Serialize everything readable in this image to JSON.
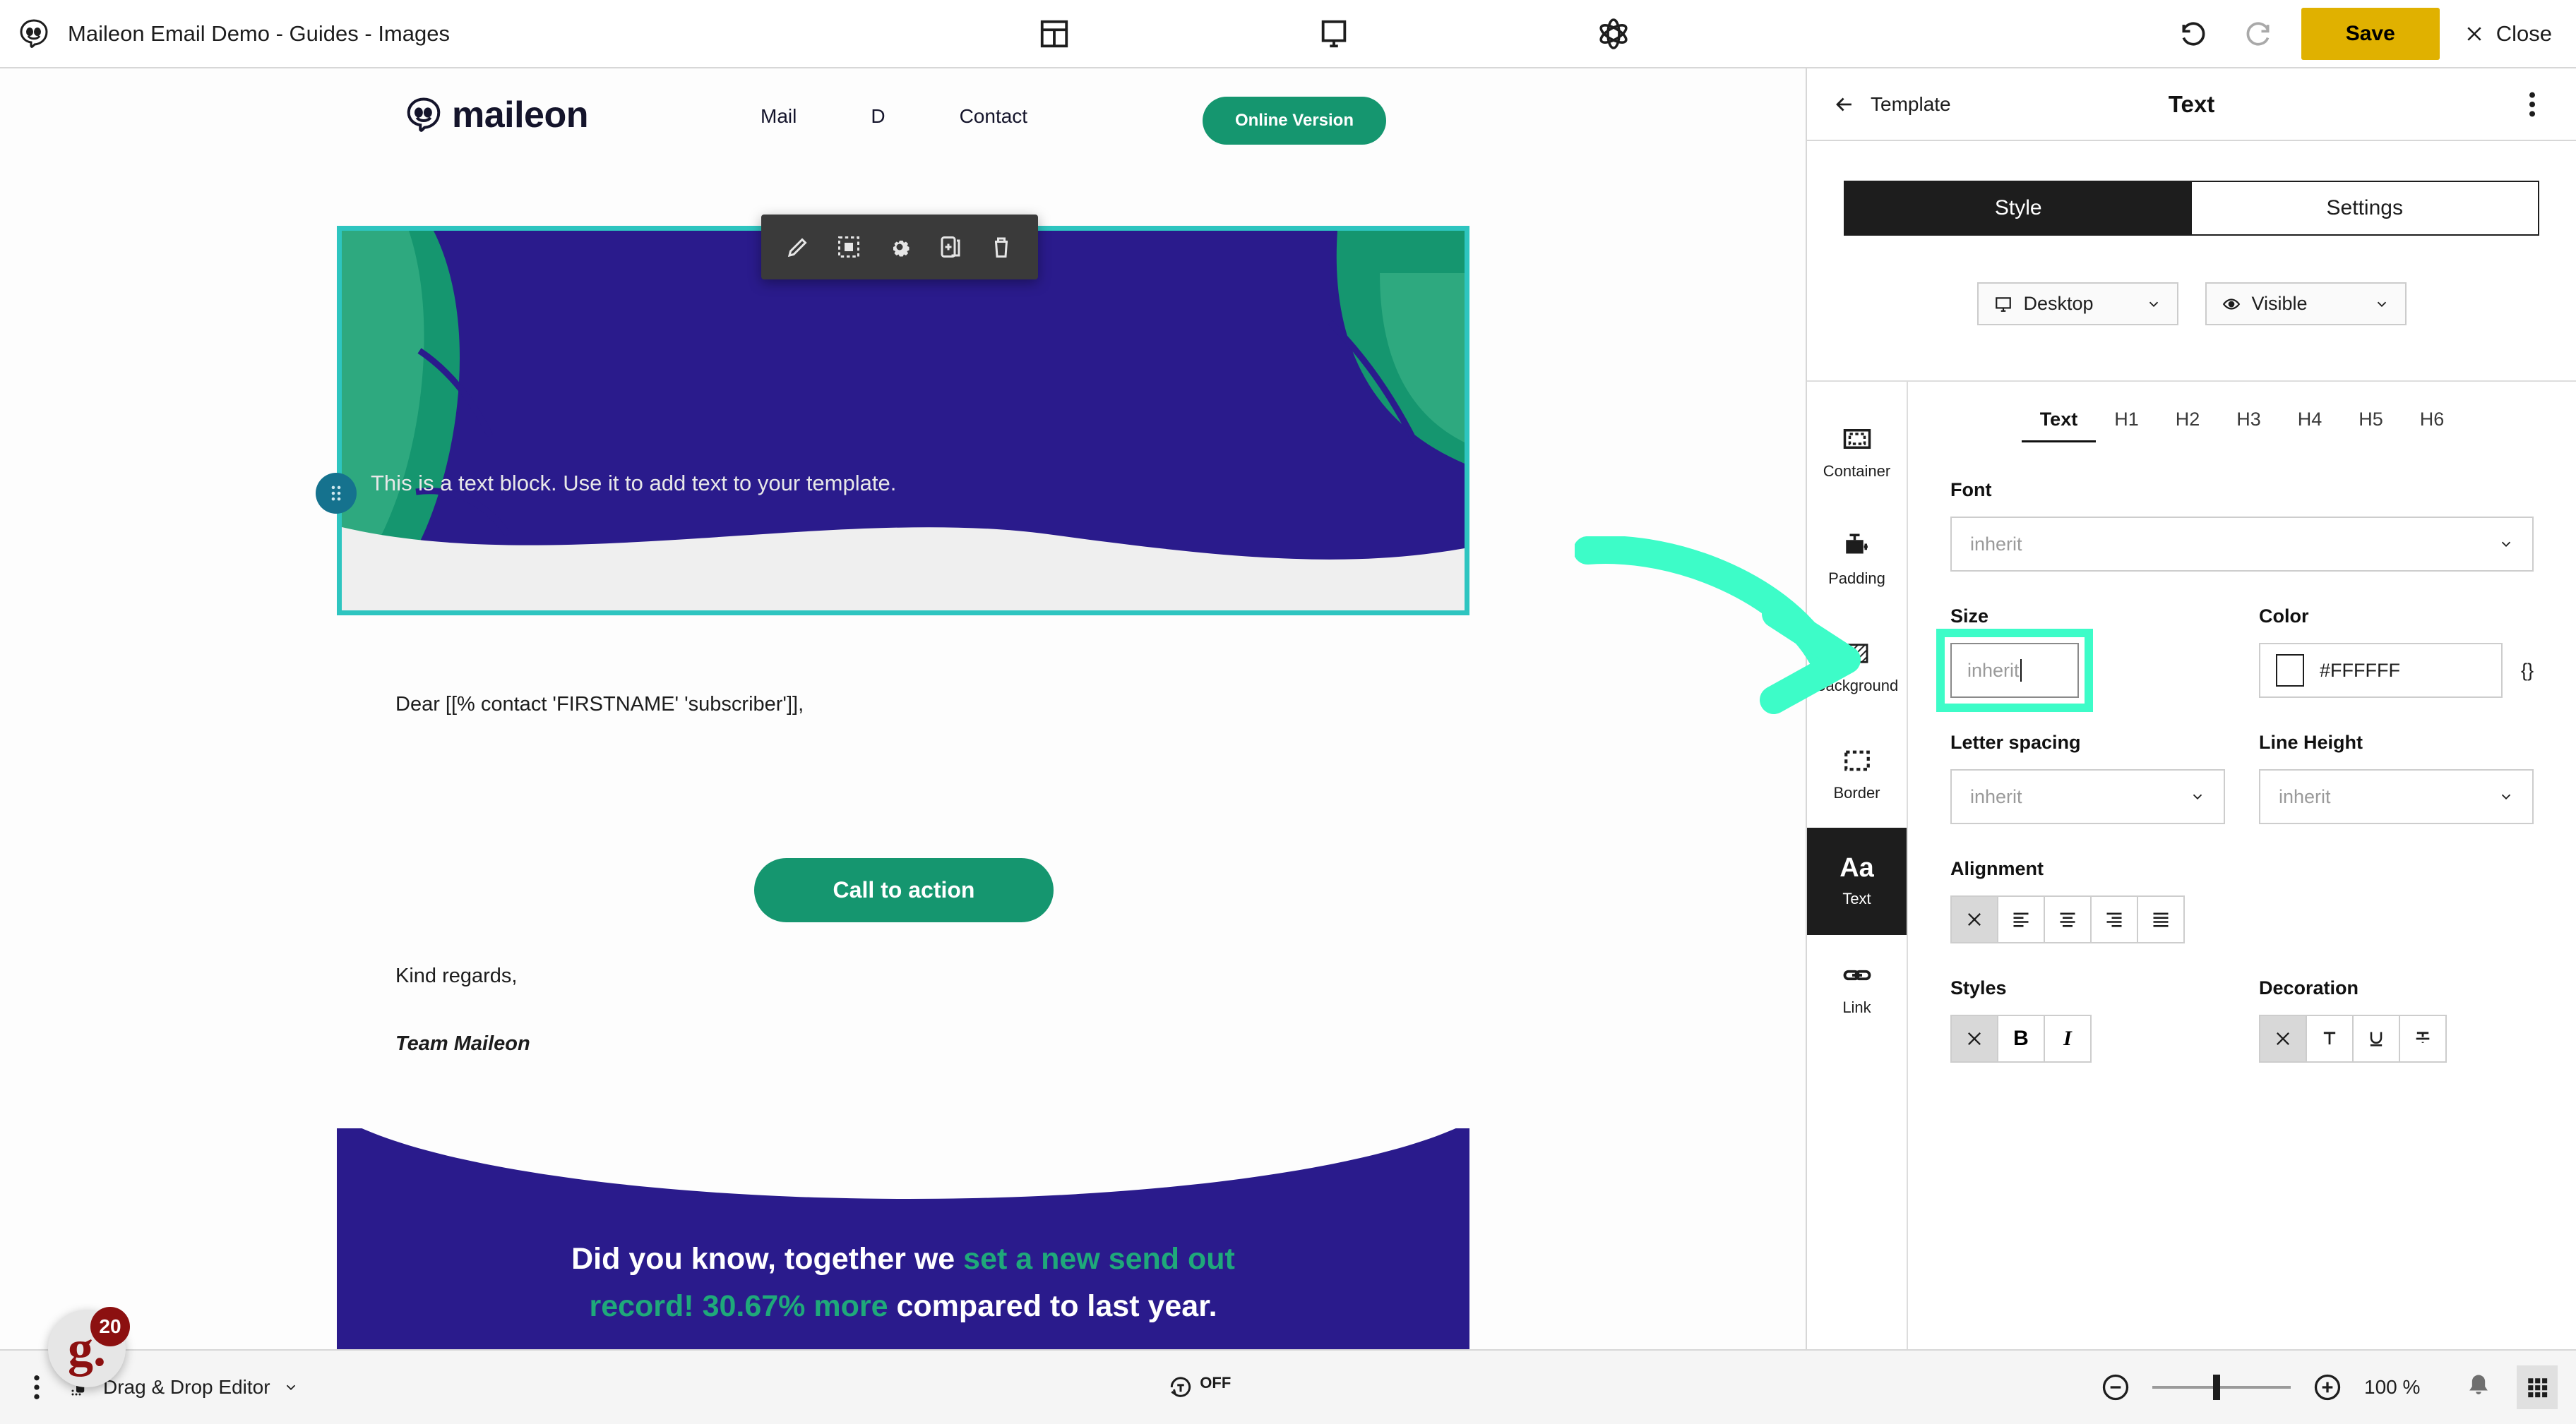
{
  "topbar": {
    "app_icon": "maileon-logo-icon",
    "document_title": "Maileon Email Demo - Guides - Images",
    "center_icons": [
      {
        "name": "layout-blocks-icon"
      },
      {
        "name": "desktop-preview-icon"
      },
      {
        "name": "atom-settings-icon"
      }
    ],
    "undo_label": "undo-icon",
    "redo_label": "redo-icon",
    "save_label": "Save",
    "close_label": "Close"
  },
  "email": {
    "brand_name": "maileon",
    "nav": [
      "Mail",
      "D",
      "Contact"
    ],
    "online_version_label": "Online Version",
    "block_toolbar": [
      {
        "name": "edit-pencil-icon"
      },
      {
        "name": "select-block-icon"
      },
      {
        "name": "gear-settings-icon"
      },
      {
        "name": "duplicate-block-icon"
      },
      {
        "name": "delete-trash-icon"
      }
    ],
    "hero_text": "This is a text block. Use it to add text to your template.",
    "greeting": "Dear [[% contact 'FIRSTNAME' 'subscriber']],",
    "cta_label": "Call to action",
    "closing": "Kind regards,",
    "signature": "Team Maileon",
    "banner": {
      "line1_a": "Did you know, together we ",
      "line1_b": "set a new send out",
      "line2_a": "record! 30.67% more",
      "line2_b": " compared to last year."
    }
  },
  "panel": {
    "back_label": "Template",
    "title": "Text",
    "tabs": [
      {
        "label": "Style",
        "active": true
      },
      {
        "label": "Settings",
        "active": false
      }
    ],
    "device_select": {
      "value": "Desktop",
      "icon": "monitor-icon"
    },
    "visibility_select": {
      "value": "Visible",
      "icon": "eye-icon"
    },
    "rail": [
      {
        "label": "Container",
        "icon": "container-icon",
        "active": false
      },
      {
        "label": "Padding",
        "icon": "padding-icon",
        "active": false
      },
      {
        "label": "Background",
        "icon": "background-hatch-icon",
        "active": false
      },
      {
        "label": "Border",
        "icon": "border-dashed-icon",
        "active": false
      },
      {
        "label": "Text",
        "icon": "text-aa-icon",
        "active": true
      },
      {
        "label": "Link",
        "icon": "link-chain-icon",
        "active": false
      }
    ],
    "heading_tabs": [
      {
        "label": "Text",
        "active": true
      },
      {
        "label": "H1",
        "active": false
      },
      {
        "label": "H2",
        "active": false
      },
      {
        "label": "H3",
        "active": false
      },
      {
        "label": "H4",
        "active": false
      },
      {
        "label": "H5",
        "active": false
      },
      {
        "label": "H6",
        "active": false
      }
    ],
    "font": {
      "label": "Font",
      "value": "inherit"
    },
    "size": {
      "label": "Size",
      "value": "inherit"
    },
    "color": {
      "label": "Color",
      "value": "#FFFFFF",
      "swatch": "#FFFFFF",
      "code_toggle": "{}"
    },
    "letter_spacing": {
      "label": "Letter spacing",
      "value": "inherit"
    },
    "line_height": {
      "label": "Line Height",
      "value": "inherit"
    },
    "alignment": {
      "label": "Alignment",
      "options": [
        {
          "name": "align-none-icon",
          "active": true
        },
        {
          "name": "align-left-icon",
          "active": false
        },
        {
          "name": "align-center-icon",
          "active": false
        },
        {
          "name": "align-right-icon",
          "active": false
        },
        {
          "name": "align-justify-icon",
          "active": false
        }
      ]
    },
    "styles": {
      "label": "Styles",
      "options": [
        {
          "name": "style-none-icon",
          "label": "✕",
          "active": true
        },
        {
          "name": "bold-icon",
          "label": "B",
          "active": false
        },
        {
          "name": "italic-icon",
          "label": "I",
          "active": false
        }
      ]
    },
    "decoration": {
      "label": "Decoration",
      "options": [
        {
          "name": "decoration-none-icon",
          "label": "✕",
          "active": true
        },
        {
          "name": "overline-icon",
          "label": "T",
          "active": false
        },
        {
          "name": "underline-icon",
          "label": "U",
          "active": false
        },
        {
          "name": "strikethrough-icon",
          "label": "S",
          "active": false
        }
      ]
    }
  },
  "bottombar": {
    "menu_icon": "kebab-menu-icon",
    "editor_label": "Drag & Drop Editor",
    "toggle_label": "OFF",
    "zoom_out_icon": "zoom-out-icon",
    "zoom_in_icon": "zoom-in-icon",
    "zoom_value": "100 %",
    "bell_icon": "notifications-bell-icon",
    "apps_icon": "apps-grid-icon"
  },
  "help_badge": {
    "glyph": "g.",
    "count": "20"
  },
  "colors": {
    "accent_green": "#15966f",
    "brand_purple": "#2a1b8c",
    "highlight_cyan": "#3dfcc8",
    "save_yellow": "#e0b100",
    "selection_teal": "#2ec5c0"
  }
}
